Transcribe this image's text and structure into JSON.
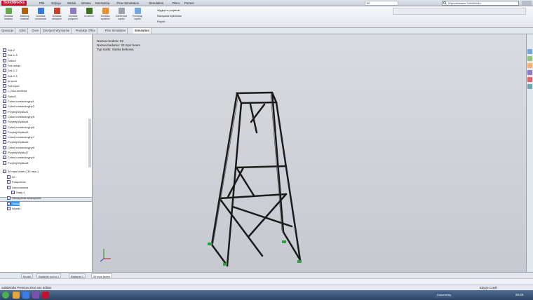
{
  "app": {
    "logo": "SolidWorks",
    "document_name": "02",
    "search_placeholder": "Wyszukiwanie SolidWorks"
  },
  "menu": [
    "Plik",
    "Edycja",
    "Widok",
    "Wstaw",
    "Narzędzia",
    "Flow Simulation",
    "Simulation",
    "Okno",
    "Pomoc"
  ],
  "ribbon": {
    "buttons": [
      {
        "label": "Doradca badania",
        "icon": "study-advisor-icon",
        "color": "#6aa84f"
      },
      {
        "label": "Zastosuj materiał",
        "icon": "material-icon",
        "color": "#b45f06"
      },
      {
        "label": "Doradca umocowań",
        "icon": "fixture-advisor-icon",
        "color": "#3c78d8"
      },
      {
        "label": "Doradca obciążeń z...",
        "icon": "load-advisor-icon",
        "color": "#cc4125"
      },
      {
        "label": "Doradca połączeń",
        "icon": "connection-advisor-icon",
        "color": "#8e7cc3"
      },
      {
        "label": "Uruchom",
        "icon": "run-icon",
        "color": "#38761d"
      },
      {
        "label": "Doradca wyników",
        "icon": "results-advisor-icon",
        "color": "#e69138"
      },
      {
        "label": "Zdeformowane wyniki",
        "icon": "deformed-result-icon",
        "color": "#9aa2b0"
      },
      {
        "label": "Porównaj wyniki",
        "icon": "compare-results-icon",
        "color": "#6fa8dc"
      }
    ],
    "side_items": [
      "Wygląd w projekcie",
      "Narzędzia wykresów",
      "Raport"
    ]
  },
  "tabs": [
    "Operacje",
    "Szkic",
    "Ocen",
    "DimXpert Wymiarów",
    "Produkty Office",
    "Flow Simulation",
    "Simulation"
  ],
  "active_tab": "Simulation",
  "tree": {
    "items": [
      {
        "label": "Szk.2",
        "icon": "sketch-icon"
      },
      {
        "label": "Szk.1-3",
        "icon": "sketch-icon"
      },
      {
        "label": "Szkic4",
        "icon": "sketch-icon"
      },
      {
        "label": "Szk.ustoje",
        "icon": "sketch-icon"
      },
      {
        "label": "Szk.1-2",
        "icon": "sketch-icon"
      },
      {
        "label": "Szk.2-3",
        "icon": "sketch-icon"
      },
      {
        "label": "pl.spod",
        "icon": "plane-icon"
      },
      {
        "label": "Szk.spod",
        "icon": "sketch-icon"
      },
      {
        "label": "(-) Szk.ramiona",
        "icon": "sketch-icon"
      },
      {
        "label": "Szkic5",
        "icon": "sketch-icon"
      },
      {
        "label": "Człon konstrukcyjny1",
        "icon": "weldment-icon"
      },
      {
        "label": "Człon konstrukcyjny2",
        "icon": "weldment-icon"
      },
      {
        "label": "Przytnij/Wydłuż1",
        "icon": "trim-icon"
      },
      {
        "label": "Człon konstrukcyjny5",
        "icon": "weldment-icon"
      },
      {
        "label": "Przytnij/Wydłuż4",
        "icon": "trim-icon"
      },
      {
        "label": "Człon konstrukcyjny6",
        "icon": "weldment-icon"
      },
      {
        "label": "Przytnij/Wydłuż5",
        "icon": "trim-icon"
      },
      {
        "label": "Człon konstrukcyjny7",
        "icon": "weldment-icon"
      },
      {
        "label": "Przytnij/Wydłuż6",
        "icon": "trim-icon"
      },
      {
        "label": "Człon konstrukcyjny8",
        "icon": "weldment-icon"
      },
      {
        "label": "Przytnij/Wydłuż7",
        "icon": "trim-icon"
      },
      {
        "label": "Człon konstrukcyjny9",
        "icon": "weldment-icon"
      },
      {
        "label": "Przytnij/Wydłuż8",
        "icon": "trim-icon"
      }
    ],
    "study_items": [
      {
        "label": "30 mps beam (-30 mps-)",
        "icon": "study-icon",
        "indent": 0
      },
      {
        "label": "02",
        "icon": "part-icon",
        "indent": 1
      },
      {
        "label": "Połączenia",
        "icon": "connections-icon",
        "indent": 1
      },
      {
        "label": "Umocowania",
        "icon": "fixtures-icon",
        "indent": 1
      },
      {
        "label": "Stały-1",
        "icon": "fixed-icon",
        "indent": 2
      },
      {
        "label": "Obciążenia zewnętrzne",
        "icon": "external-loads-icon",
        "indent": 1
      },
      {
        "label": "Siatka",
        "icon": "mesh-icon",
        "indent": 1,
        "selected": true
      },
      {
        "label": "Wyniki",
        "icon": "results-icon",
        "indent": 1
      }
    ]
  },
  "viewport": {
    "model_label": "Nazwa modelu: 02",
    "study_label": "Nazwa badania: 30 mps beam",
    "plot_label": "Typ siatki: Siatka belkowa"
  },
  "bottom_tabs": [
    "Model",
    "Badanie ruchu 1",
    "Badanie 1",
    "30 mps beam"
  ],
  "active_bottom_tab": "30 mps beam",
  "status": {
    "left": "SolidWorks Premium 2010 x64 Edition",
    "right": "Edycja Część"
  },
  "taskbar": {
    "documents_label": "Dokumenty",
    "clock": "20:25"
  }
}
